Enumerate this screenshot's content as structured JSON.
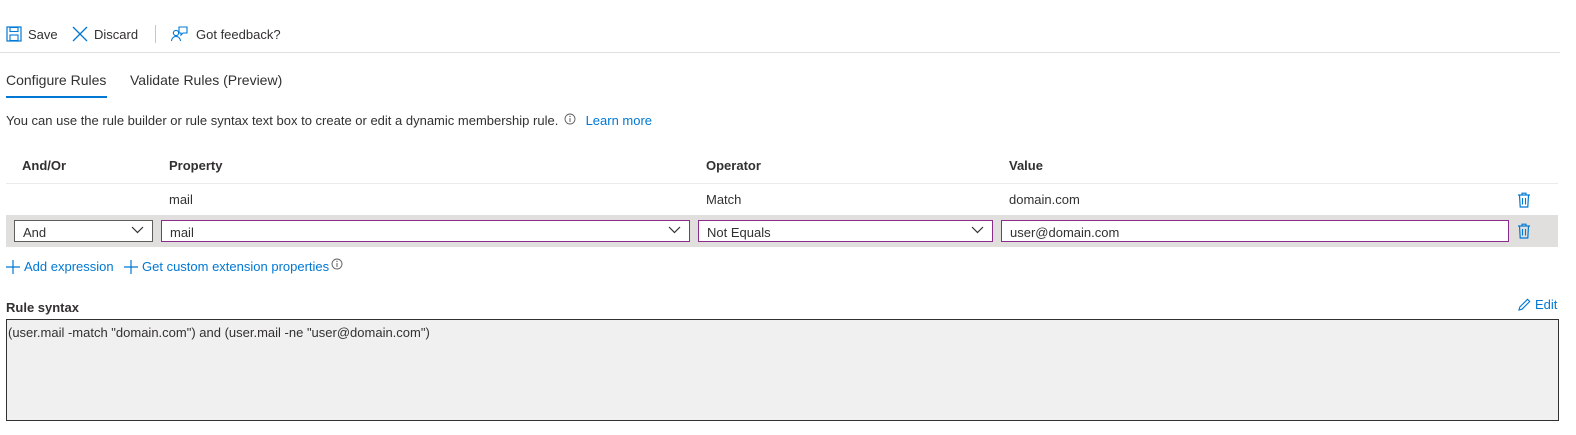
{
  "toolbar": {
    "save_label": "Save",
    "discard_label": "Discard",
    "feedback_label": "Got feedback?"
  },
  "tabs": [
    {
      "label": "Configure Rules",
      "active": true
    },
    {
      "label": "Validate Rules (Preview)",
      "active": false
    }
  ],
  "description": {
    "text": "You can use the rule builder or rule syntax text box to create or edit a dynamic membership rule.",
    "learn_more": "Learn more"
  },
  "table": {
    "headers": {
      "and_or": "And/Or",
      "property": "Property",
      "operator": "Operator",
      "value": "Value"
    },
    "rows": [
      {
        "and_or": "",
        "property": "mail",
        "operator": "Match",
        "value": "domain.com"
      },
      {
        "and_or": "And",
        "property": "mail",
        "operator": "Not Equals",
        "value": "user@domain.com"
      }
    ]
  },
  "actions": {
    "add_expression": "Add expression",
    "get_custom": "Get custom extension properties"
  },
  "rule_syntax": {
    "title": "Rule syntax",
    "edit_label": "Edit",
    "text": "(user.mail -match \"domain.com\") and (user.mail -ne \"user@domain.com\")"
  },
  "colors": {
    "accent": "#0078d4",
    "focus_border": "#8a2c8a",
    "row_highlight": "#e1dfdd",
    "syntax_bg": "#f0f0f0"
  }
}
